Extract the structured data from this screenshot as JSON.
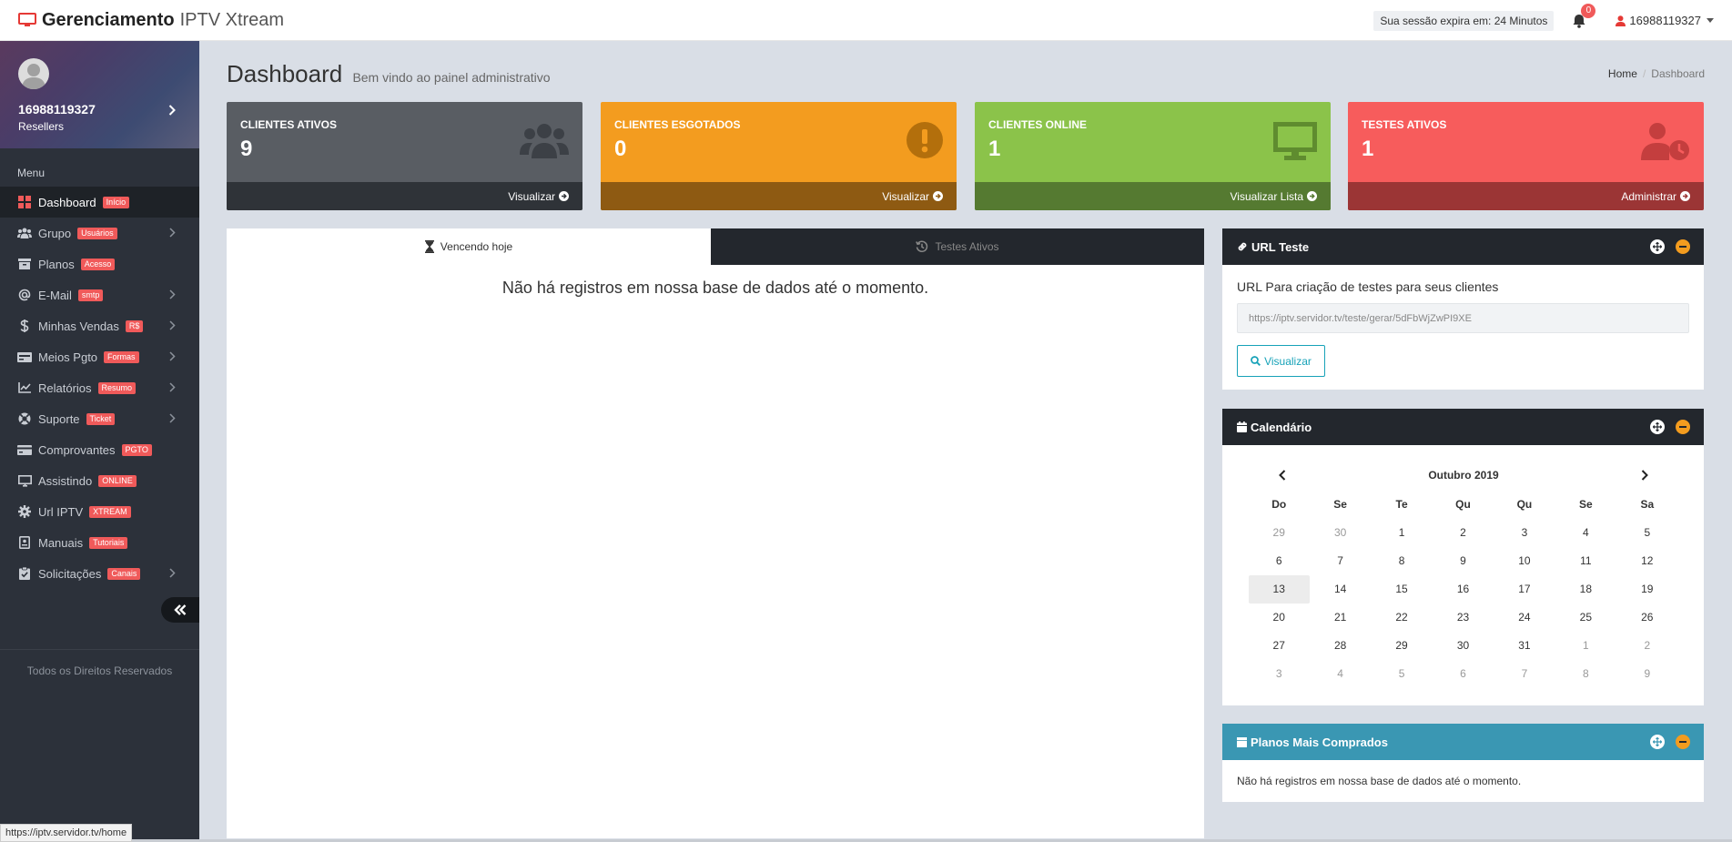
{
  "brand": {
    "bold": "Gerenciamento",
    "light": "IPTV Xtream"
  },
  "topbar": {
    "session": "Sua sessão expira em: 24 Minutos",
    "notifications": "0",
    "user": "16988119327"
  },
  "profile": {
    "username": "16988119327",
    "role": "Resellers"
  },
  "sidebar": {
    "menu_label": "Menu",
    "items": [
      {
        "label": "Dashboard",
        "tag": "Início"
      },
      {
        "label": "Grupo",
        "tag": "Usuários"
      },
      {
        "label": "Planos",
        "tag": "Acesso"
      },
      {
        "label": "E-Mail",
        "tag": "smtp"
      },
      {
        "label": "Minhas Vendas",
        "tag": "R$"
      },
      {
        "label": "Meios Pgto",
        "tag": "Formas"
      },
      {
        "label": "Relatórios",
        "tag": "Resumo"
      },
      {
        "label": "Suporte",
        "tag": "Ticket"
      },
      {
        "label": "Comprovantes",
        "tag": "PGTO"
      },
      {
        "label": "Assistindo",
        "tag": "ONLINE"
      },
      {
        "label": "Url IPTV",
        "tag": "XTREAM"
      },
      {
        "label": "Manuais",
        "tag": "Tutoriais"
      },
      {
        "label": "Solicitações",
        "tag": "Canais"
      }
    ],
    "rights": "Todos os Direitos Reservados"
  },
  "page": {
    "title": "Dashboard",
    "subtitle": "Bem vindo ao painel administrativo"
  },
  "breadcrumb": {
    "home": "Home",
    "current": "Dashboard"
  },
  "stats": [
    {
      "label": "CLIENTES ATIVOS",
      "value": "9",
      "link": "Visualizar",
      "color": "#595d63",
      "footer_color": "#2f3338"
    },
    {
      "label": "CLIENTES ESGOTADOS",
      "value": "0",
      "link": "Visualizar",
      "color": "#f39c1f",
      "footer_color": "#8e5a12"
    },
    {
      "label": "CLIENTES ONLINE",
      "value": "1",
      "link": "Visualizar Lista",
      "color": "#8bc34a",
      "footer_color": "#557a31"
    },
    {
      "label": "TESTES ATIVOS",
      "value": "1",
      "link": "Administrar",
      "color": "#f75c5c",
      "footer_color": "#9b3535"
    }
  ],
  "tabs": {
    "active": "Vencendo hoje",
    "inactive": "Testes Ativos"
  },
  "empty_message": "Não há registros em nossa base de dados até o momento.",
  "url_teste": {
    "title": "URL Teste",
    "label": "URL Para criação de testes para seus clientes",
    "url": "https://iptv.servidor.tv/teste/gerar/5dFbWjZwPI9XE",
    "button": "Visualizar"
  },
  "calendar": {
    "title": "Calendário",
    "month": "Outubro 2019",
    "day_names": [
      "Do",
      "Se",
      "Te",
      "Qu",
      "Qu",
      "Se",
      "Sa"
    ],
    "weeks": [
      [
        "29",
        "30",
        "1",
        "2",
        "3",
        "4",
        "5"
      ],
      [
        "6",
        "7",
        "8",
        "9",
        "10",
        "11",
        "12"
      ],
      [
        "13",
        "14",
        "15",
        "16",
        "17",
        "18",
        "19"
      ],
      [
        "20",
        "21",
        "22",
        "23",
        "24",
        "25",
        "26"
      ],
      [
        "27",
        "28",
        "29",
        "30",
        "31",
        "1",
        "2"
      ],
      [
        "3",
        "4",
        "5",
        "6",
        "7",
        "8",
        "9"
      ]
    ],
    "today": "13"
  },
  "planos": {
    "title": "Planos Mais Comprados",
    "message": "Não há registros em nossa base de dados até o momento."
  },
  "status_url": "https://iptv.servidor.tv/home"
}
